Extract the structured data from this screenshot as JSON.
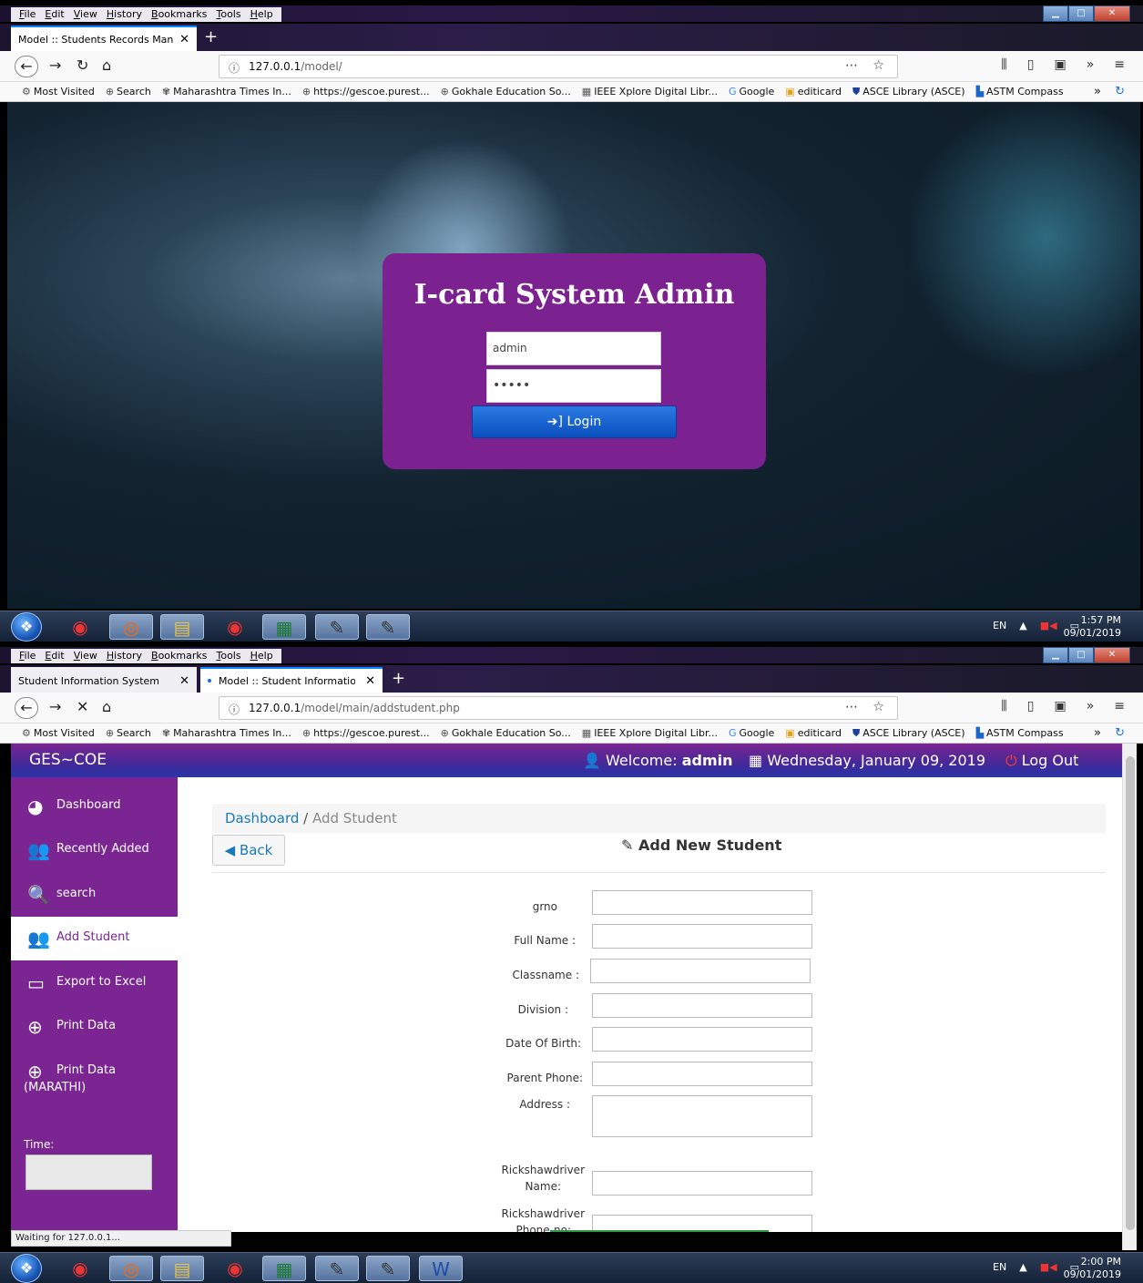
{
  "browser": {
    "menu": [
      "File",
      "Edit",
      "View",
      "History",
      "Bookmarks",
      "Tools",
      "Help"
    ],
    "bookmarks": [
      "Most Visited",
      "Search",
      "Maharashtra Times In...",
      "https://gescoe.purest...",
      "Gokhale Education So...",
      "IEEE Xplore Digital Libr...",
      "Google",
      "editicard",
      "ASCE Library (ASCE)",
      "ASTM Compass"
    ]
  },
  "shot1": {
    "tab_title": "Model :: Students Records Manager",
    "url_host": "127.0.0.1",
    "url_path": "/model/",
    "login": {
      "title": "I-card System Admin",
      "username_value": "admin",
      "password_value": "•••••",
      "button_label": "Login"
    },
    "taskbar": {
      "lang": "EN",
      "time": "1:57 PM",
      "date": "09/01/2019"
    }
  },
  "shot2": {
    "tabs": [
      "Student Information System",
      "Model :: Student Information S"
    ],
    "url_host": "127.0.0.1",
    "url_path": "/model/main/addstudent.php",
    "topnav": {
      "brand": "GES~COE",
      "welcome_prefix": "Welcome: ",
      "welcome_user": "admin",
      "date": "Wednesday, January 09, 2019",
      "logout": "Log Out"
    },
    "sidebar": {
      "items": [
        {
          "label": "Dashboard",
          "icon": "dashboard-icon"
        },
        {
          "label": "Recently Added",
          "icon": "users-icon"
        },
        {
          "label": "search",
          "icon": "search-icon"
        },
        {
          "label": "Add Student",
          "icon": "users-icon"
        },
        {
          "label": "Export to Excel",
          "icon": "hdd-icon"
        },
        {
          "label": "Print Data",
          "icon": "plus-circle-icon"
        },
        {
          "label": "Print Data",
          "label2": "(MARATHI)",
          "icon": "plus-circle-icon"
        }
      ],
      "time_label": "Time:"
    },
    "breadcrumb": {
      "link": "Dashboard",
      "separator": " / ",
      "current": "Add Student"
    },
    "back_label": "Back",
    "form_title": "Add New Student",
    "fields": [
      "grno",
      "Full Name :",
      "Classname :",
      "Division :",
      "Date Of Birth:",
      "Parent Phone:",
      "Address :",
      "Rickshawdriver",
      "Name:",
      "Rickshawdriver",
      "Phone-no:"
    ],
    "status": "Waiting for 127.0.0.1...",
    "taskbar": {
      "lang": "EN",
      "time": "2:00 PM",
      "date": "09/01/2019"
    }
  }
}
